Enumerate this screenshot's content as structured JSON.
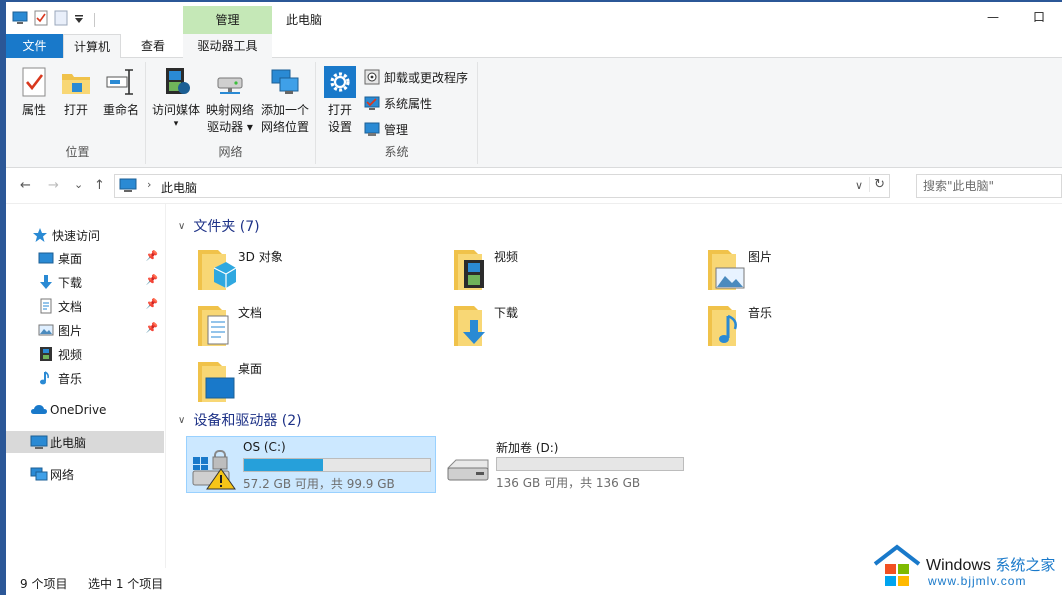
{
  "titlebar": {
    "context_tab_group": "管理",
    "title": "此电脑",
    "minimize": "—",
    "maximize": "口"
  },
  "ribbon_tabs": {
    "file": "文件",
    "computer": "计算机",
    "view": "查看",
    "drive_tools": "驱动器工具"
  },
  "ribbon": {
    "location": {
      "label": "位置",
      "properties": "属性",
      "open": "打开",
      "rename": "重命名"
    },
    "network": {
      "label": "网络",
      "access_media_line1": "访问媒体",
      "access_media_line2": "▾",
      "map_drive_line1": "映射网络",
      "map_drive_line2": "驱动器 ▾",
      "add_location_line1": "添加一个",
      "add_location_line2": "网络位置"
    },
    "system": {
      "label": "系统",
      "open_settings_line1": "打开",
      "open_settings_line2": "设置",
      "uninstall": "卸载或更改程序",
      "system_properties": "系统属性",
      "manage": "管理"
    }
  },
  "address": {
    "back": "←",
    "forward": "→",
    "recent": "⌄",
    "up": "↑",
    "crumb_separator": "›",
    "crumb": "此电脑",
    "dropdown": "∨",
    "refresh": "↻",
    "search_placeholder": "搜索\"此电脑\""
  },
  "nav": {
    "quick_access": "快速访问",
    "desktop": "桌面",
    "downloads": "下载",
    "documents": "文档",
    "pictures": "图片",
    "videos": "视频",
    "music": "音乐",
    "onedrive": "OneDrive",
    "this_pc": "此电脑",
    "network": "网络",
    "pin": "📌"
  },
  "content": {
    "chevron": "∨",
    "folders_header": "文件夹 (7)",
    "drives_header": "设备和驱动器 (2)",
    "folders": {
      "objects3d": "3D 对象",
      "videos": "视频",
      "pictures": "图片",
      "documents": "文档",
      "downloads": "下载",
      "music": "音乐",
      "desktop": "桌面"
    },
    "drives": {
      "c_name": "OS (C:)",
      "c_info": "57.2 GB 可用，共 99.9 GB",
      "c_used_fraction": 0.427,
      "d_name": "新加卷 (D:)",
      "d_info": "136 GB 可用，共 136 GB",
      "d_used_fraction": 0.0
    }
  },
  "status": {
    "count": "9 个项目",
    "selected": "选中 1 个项目"
  },
  "watermark": {
    "brand": "Windows",
    "brand_cn": "系统之家",
    "url": "www.bjjmlv.com"
  },
  "colors": {
    "accent": "#1979ca",
    "context_tab": "#c5e8b7",
    "selection": "#cce8ff",
    "drive_fill": "#26a0da"
  }
}
